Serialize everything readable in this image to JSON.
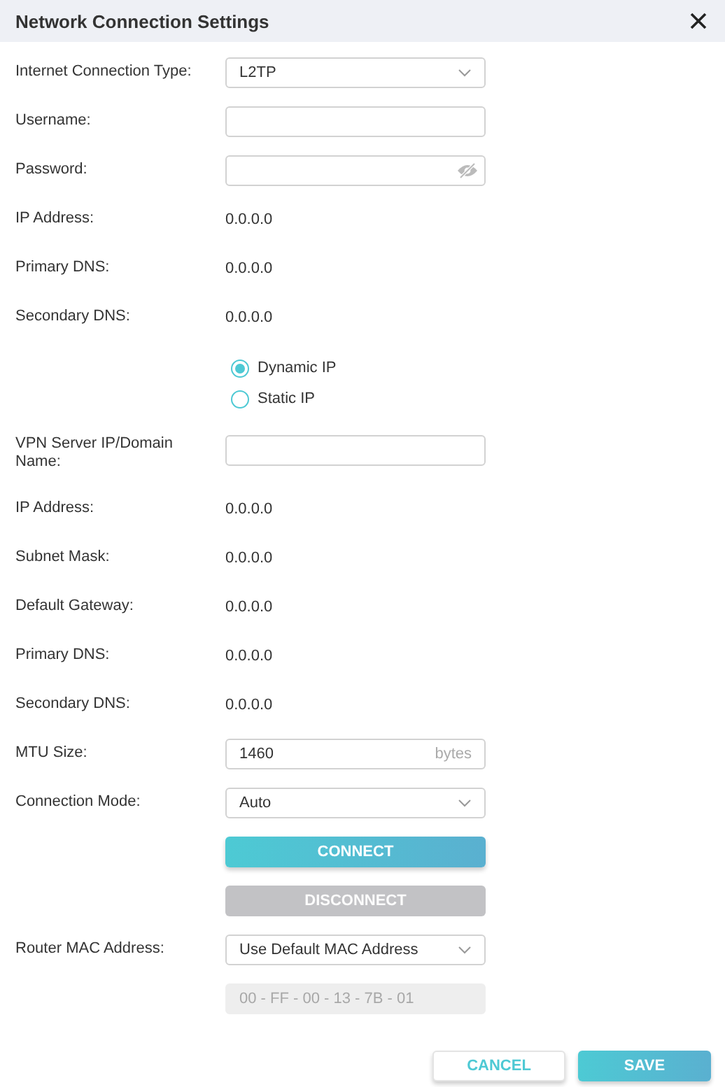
{
  "window": {
    "title": "Network Connection Settings"
  },
  "rows": [
    {
      "kind": "select",
      "label": "Internet Connection Type:",
      "value": "L2TP"
    },
    {
      "kind": "input",
      "label": "Username:"
    },
    {
      "kind": "password",
      "label": "Password:"
    },
    {
      "kind": "static",
      "label": "IP Address:",
      "value": "0.0.0.0"
    },
    {
      "kind": "static",
      "label": "Primary DNS:",
      "value": "0.0.0.0"
    },
    {
      "kind": "static",
      "label": "Secondary DNS:",
      "value": "0.0.0.0"
    },
    {
      "kind": "radios",
      "options": [
        {
          "label": "Dynamic IP",
          "selected": true
        },
        {
          "label": "Static IP",
          "selected": false
        }
      ]
    },
    {
      "kind": "input",
      "label": "VPN Server IP/Domain Name:"
    },
    {
      "kind": "static",
      "label": "IP Address:",
      "value": "0.0.0.0"
    },
    {
      "kind": "static",
      "label": "Subnet Mask:",
      "value": "0.0.0.0"
    },
    {
      "kind": "static",
      "label": "Default Gateway:",
      "value": "0.0.0.0"
    },
    {
      "kind": "static",
      "label": "Primary DNS:",
      "value": "0.0.0.0"
    },
    {
      "kind": "static",
      "label": "Secondary DNS:",
      "value": "0.0.0.0"
    },
    {
      "kind": "input",
      "label": "MTU Size:",
      "value": "1460",
      "suffix": "bytes"
    },
    {
      "kind": "select",
      "label": "Connection Mode:",
      "value": "Auto"
    },
    {
      "kind": "button",
      "label": "CONNECT",
      "disabled": false
    },
    {
      "kind": "button",
      "label": "DISCONNECT",
      "disabled": true
    },
    {
      "kind": "select",
      "label": "Router MAC Address:",
      "value": "Use Default MAC Address"
    },
    {
      "kind": "mac",
      "value": "00 - FF - 00 - 13 - 7B - 01",
      "disabled": true
    }
  ],
  "buttons": [
    {
      "label": "CANCEL",
      "primary": false
    },
    {
      "label": "SAVE",
      "primary": true
    }
  ]
}
